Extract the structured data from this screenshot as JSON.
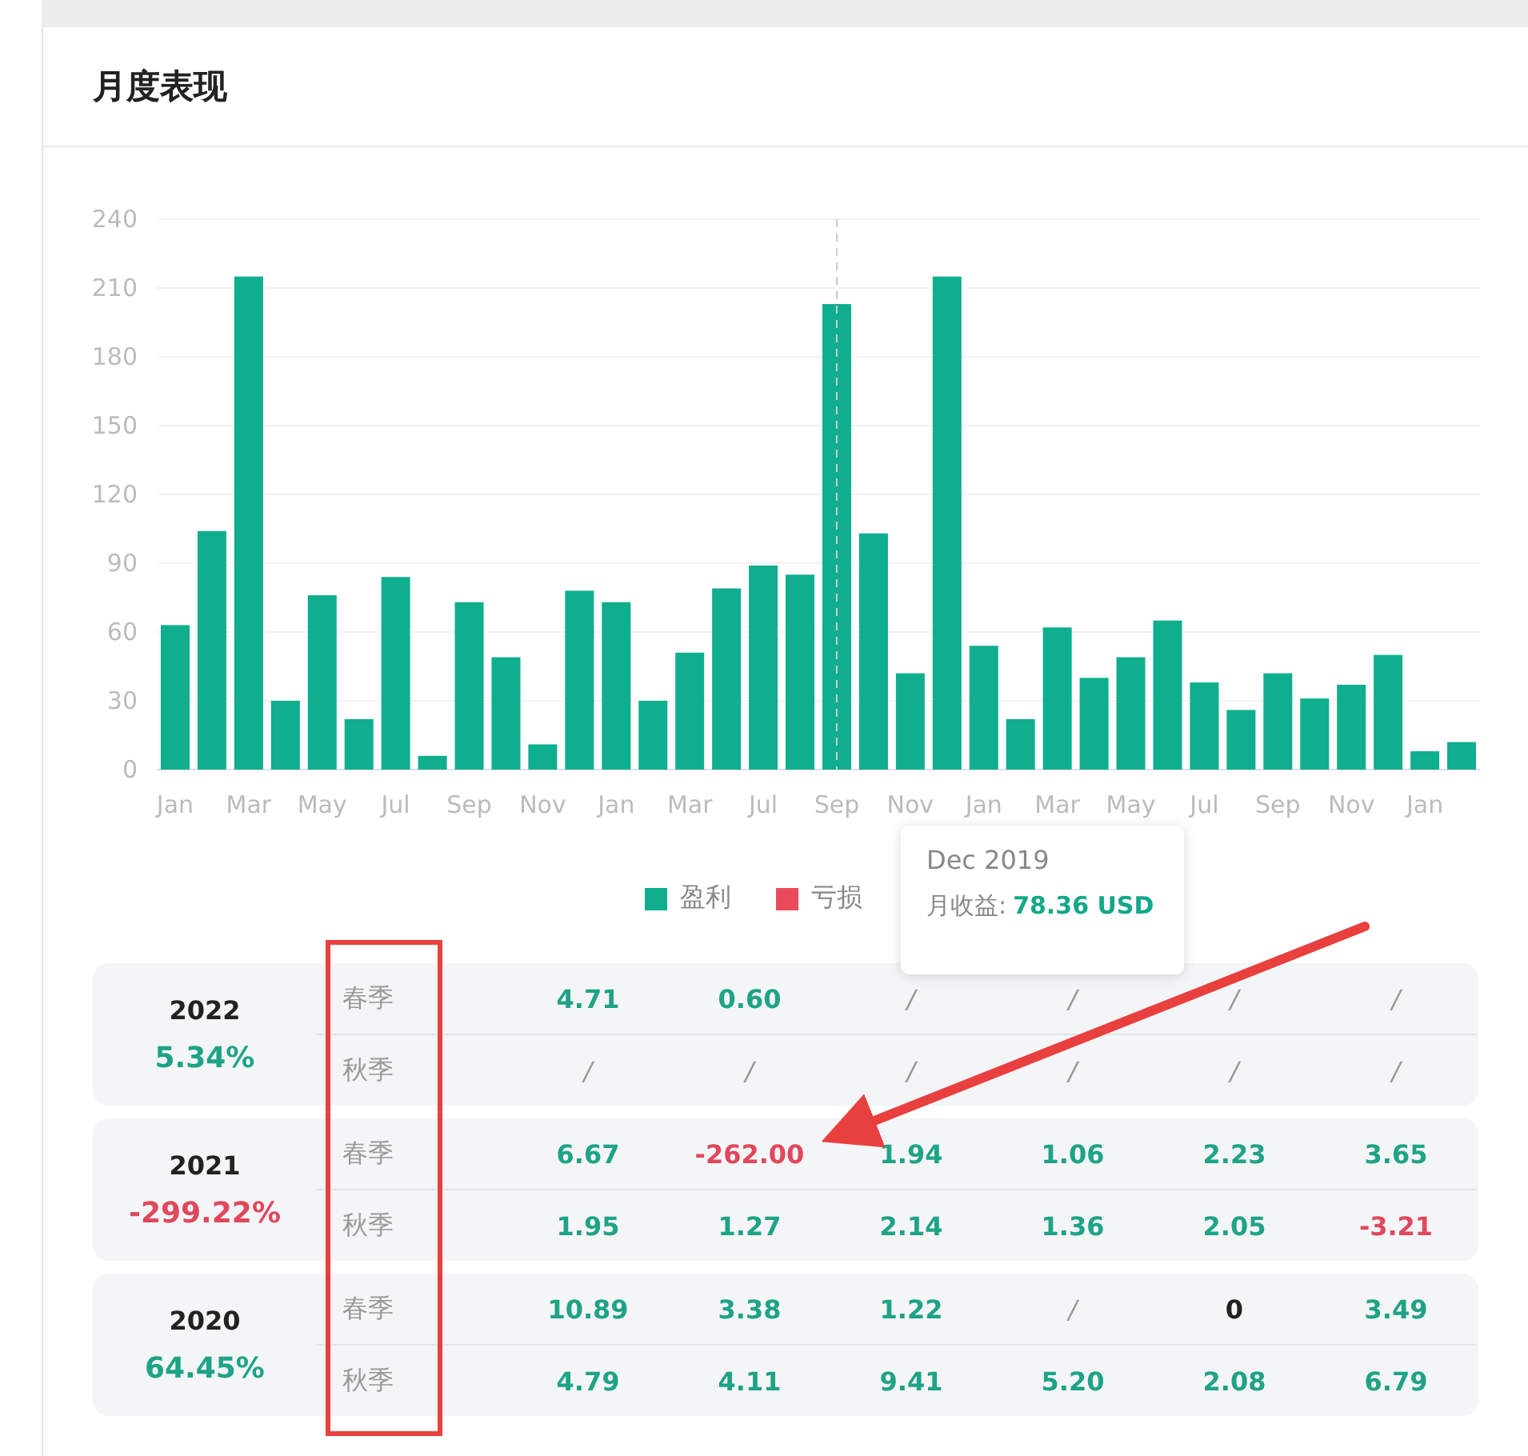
{
  "title": "月度表现",
  "chart_data": {
    "type": "bar",
    "categories": [
      "Jan",
      null,
      "Mar",
      null,
      "May",
      null,
      "Jul",
      null,
      "Sep",
      null,
      "Nov",
      null,
      "Jan",
      null,
      "Mar",
      null,
      "Jul",
      null,
      "Sep",
      null,
      "Nov",
      null,
      "Jan",
      null,
      "Mar",
      null,
      "May",
      null,
      "Jul",
      null,
      "Sep",
      null,
      "Nov",
      null,
      "Jan",
      null
    ],
    "yticks": [
      0,
      30,
      60,
      90,
      120,
      150,
      180,
      210,
      240
    ],
    "ylim": [
      0,
      240
    ],
    "grid": true,
    "series": [
      {
        "name": "盈利",
        "color": "#0fae8e",
        "values": [
          63,
          104,
          215,
          30,
          76,
          22,
          84,
          6,
          73,
          49,
          11,
          78,
          73,
          30,
          51,
          79,
          89,
          85,
          203,
          103,
          42,
          215,
          54,
          22,
          62,
          40,
          49,
          65,
          38,
          26,
          42,
          31,
          37,
          50,
          8,
          12
        ]
      },
      {
        "name": "亏损",
        "color": "#ea4b5c",
        "values": [
          null,
          null,
          null,
          null,
          null,
          null,
          null,
          null,
          null,
          null,
          null,
          null,
          null,
          null,
          null,
          null,
          null,
          null,
          null,
          null,
          null,
          null,
          null,
          null,
          null,
          null,
          null,
          null,
          null,
          null,
          null,
          null,
          null,
          null,
          null,
          null
        ]
      }
    ]
  },
  "tooltip": {
    "title": "Dec 2019",
    "label": "月收益:",
    "value": "78.36 USD"
  },
  "years": [
    {
      "year": "2022",
      "total": "5.34%",
      "kind": "gain",
      "rows": [
        {
          "season": "春季",
          "cells": [
            {
              "value": "4.71",
              "kind": "gain"
            },
            {
              "value": "0.60",
              "kind": "gain"
            },
            {
              "value": "/",
              "kind": "none"
            },
            {
              "value": "/",
              "kind": "none"
            },
            {
              "value": "/",
              "kind": "none"
            },
            {
              "value": "/",
              "kind": "none"
            }
          ]
        },
        {
          "season": "秋季",
          "cells": [
            {
              "value": "/",
              "kind": "none"
            },
            {
              "value": "/",
              "kind": "none"
            },
            {
              "value": "/",
              "kind": "none"
            },
            {
              "value": "/",
              "kind": "none"
            },
            {
              "value": "/",
              "kind": "none"
            },
            {
              "value": "/",
              "kind": "none"
            }
          ]
        }
      ]
    },
    {
      "year": "2021",
      "total": "-299.22%",
      "kind": "loss",
      "rows": [
        {
          "season": "春季",
          "cells": [
            {
              "value": "6.67",
              "kind": "gain"
            },
            {
              "value": "-262.00",
              "kind": "loss"
            },
            {
              "value": "1.94",
              "kind": "gain"
            },
            {
              "value": "1.06",
              "kind": "gain"
            },
            {
              "value": "2.23",
              "kind": "gain"
            },
            {
              "value": "3.65",
              "kind": "gain"
            }
          ]
        },
        {
          "season": "秋季",
          "cells": [
            {
              "value": "1.95",
              "kind": "gain"
            },
            {
              "value": "1.27",
              "kind": "gain"
            },
            {
              "value": "2.14",
              "kind": "gain"
            },
            {
              "value": "1.36",
              "kind": "gain"
            },
            {
              "value": "2.05",
              "kind": "gain"
            },
            {
              "value": "-3.21",
              "kind": "loss"
            }
          ]
        }
      ]
    },
    {
      "year": "2020",
      "total": "64.45%",
      "kind": "gain",
      "rows": [
        {
          "season": "春季",
          "cells": [
            {
              "value": "10.89",
              "kind": "gain"
            },
            {
              "value": "3.38",
              "kind": "gain"
            },
            {
              "value": "1.22",
              "kind": "gain"
            },
            {
              "value": "/",
              "kind": "none"
            },
            {
              "value": "0",
              "kind": "zero"
            },
            {
              "value": "3.49",
              "kind": "gain"
            }
          ]
        },
        {
          "season": "秋季",
          "cells": [
            {
              "value": "4.79",
              "kind": "gain"
            },
            {
              "value": "4.11",
              "kind": "gain"
            },
            {
              "value": "9.41",
              "kind": "gain"
            },
            {
              "value": "5.20",
              "kind": "gain"
            },
            {
              "value": "2.08",
              "kind": "gain"
            },
            {
              "value": "6.79",
              "kind": "gain"
            }
          ]
        }
      ]
    }
  ]
}
